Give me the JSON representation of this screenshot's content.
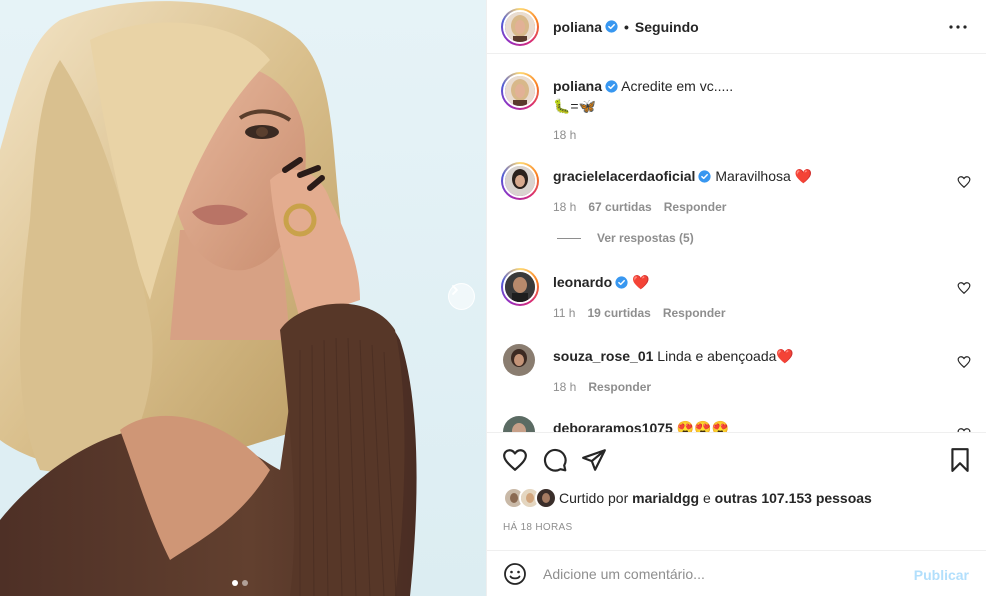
{
  "post": {
    "author": "poliana",
    "follow_state": "Seguindo",
    "header_separator": "•",
    "more_icon": "more-horizontal-icon"
  },
  "caption": {
    "username": "poliana",
    "text": "Acredite em vc.....",
    "emoji_line": "🐛=🦋",
    "time": "18 h"
  },
  "comments": [
    {
      "username": "gracielelacerdaoficial",
      "verified": true,
      "text": "Maravilhosa ❤️",
      "time": "18 h",
      "likes": "67 curtidas",
      "reply": "Responder"
    },
    {
      "username": "leonardo",
      "verified": true,
      "text": "❤️",
      "time": "11 h",
      "likes": "19 curtidas",
      "reply": "Responder"
    },
    {
      "username": "souza_rose_01",
      "verified": false,
      "text": "Linda e abençoada❤️",
      "time": "18 h",
      "likes": "",
      "reply": "Responder"
    },
    {
      "username": "deboraramos1075",
      "verified": false,
      "text": "😍😍😍",
      "time": "",
      "likes": "",
      "reply": ""
    }
  ],
  "view_replies": "Ver respostas (5)",
  "likes_summary": {
    "prefix": "Curtido por",
    "user": "marialdgg",
    "middle": "e",
    "others": "outras 107.153 pessoas"
  },
  "timestamp": "HÁ 18 HORAS",
  "add_comment": {
    "placeholder": "Adicione um comentário...",
    "publish": "Publicar"
  },
  "carousel": {
    "current": 1,
    "total": 2
  },
  "colors": {
    "verified": "#3897f0",
    "heart": "#ed4956",
    "publish_disabled": "#b2dffc",
    "muted": "#8e8e8e"
  }
}
